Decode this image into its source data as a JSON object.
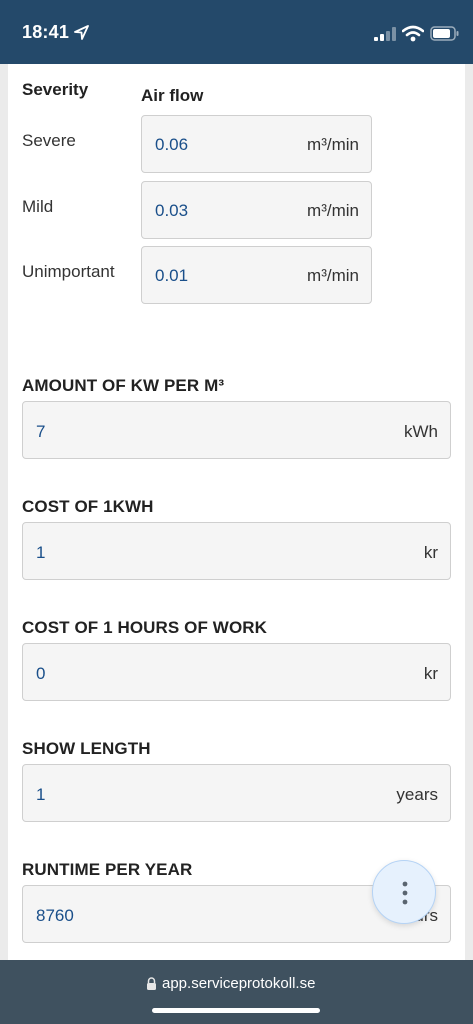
{
  "status_bar": {
    "time": "18:41"
  },
  "severity_table": {
    "header_severity": "Severity",
    "header_airflow": "Air flow",
    "rows": [
      {
        "label": "Severe",
        "value": "0.06",
        "unit": "m³/min"
      },
      {
        "label": "Mild",
        "value": "0.03",
        "unit": "m³/min"
      },
      {
        "label": "Unimportant",
        "value": "0.01",
        "unit": "m³/min"
      }
    ]
  },
  "fields": [
    {
      "label": "AMOUNT OF KW PER M³",
      "value": "7",
      "unit": "kWh"
    },
    {
      "label": "COST OF 1KWH",
      "value": "1",
      "unit": "kr"
    },
    {
      "label": "COST OF 1 HOURS OF WORK",
      "value": "0",
      "unit": "kr"
    },
    {
      "label": "SHOW LENGTH",
      "value": "1",
      "unit": "years"
    },
    {
      "label": "RUNTIME PER YEAR",
      "value": "8760",
      "unit": "hours"
    }
  ],
  "browser": {
    "url": "app.serviceprotokoll.se"
  },
  "icons": {
    "location": "location-arrow-icon",
    "signal": "cellular-signal-icon",
    "wifi": "wifi-icon",
    "battery": "battery-icon",
    "menu": "more-vertical-icon",
    "lock": "lock-icon"
  },
  "colors": {
    "status_bar": "#24496a",
    "value_text": "#1a4f8a",
    "browser_bar": "#3f515f",
    "fab_background": "#e6f1fd"
  }
}
